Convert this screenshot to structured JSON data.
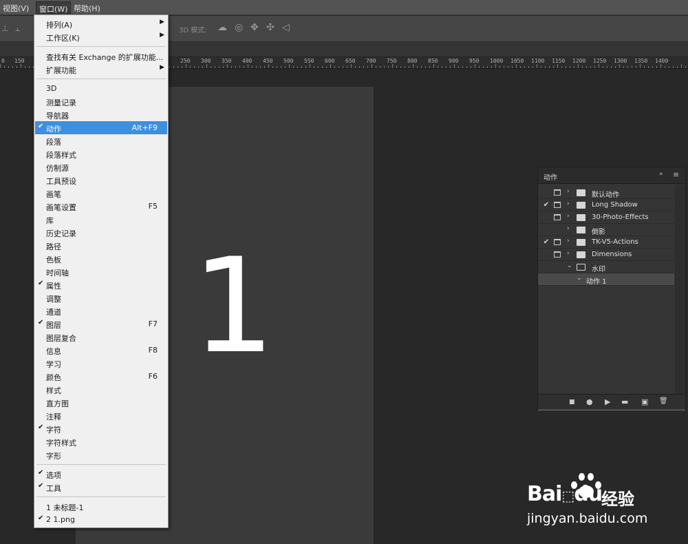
{
  "menubar": {
    "items": [
      {
        "label": "视图(V)"
      },
      {
        "label": "窗口(W)"
      },
      {
        "label": "帮助(H)"
      }
    ]
  },
  "options_bar": {
    "mode_3d_label": "3D 模式:"
  },
  "ruler": {
    "labels": [
      "0",
      "150",
      "250",
      "300",
      "350",
      "400",
      "450",
      "500",
      "550",
      "600",
      "650",
      "700",
      "750",
      "800",
      "850",
      "900",
      "950",
      "1000",
      "1050",
      "1100",
      "1150",
      "1200",
      "1250",
      "1300",
      "1350",
      "1400"
    ]
  },
  "canvas": {
    "content": "1"
  },
  "window_menu": {
    "items": [
      {
        "label": "排列(A)",
        "submenu": true
      },
      {
        "label": "工作区(K)",
        "submenu": true
      },
      {
        "separator": true
      },
      {
        "label": "查找有关 Exchange 的扩展功能..."
      },
      {
        "label": "扩展功能",
        "submenu": true
      },
      {
        "separator": true
      },
      {
        "label": "3D"
      },
      {
        "label": "测量记录"
      },
      {
        "label": "导航器"
      },
      {
        "label": "动作",
        "checked": true,
        "shortcut": "Alt+F9",
        "highlighted": true
      },
      {
        "label": "段落"
      },
      {
        "label": "段落样式"
      },
      {
        "label": "仿制源"
      },
      {
        "label": "工具预设"
      },
      {
        "label": "画笔"
      },
      {
        "label": "画笔设置",
        "shortcut": "F5"
      },
      {
        "label": "库"
      },
      {
        "label": "历史记录"
      },
      {
        "label": "路径"
      },
      {
        "label": "色板"
      },
      {
        "label": "时间轴"
      },
      {
        "label": "属性",
        "checked": true
      },
      {
        "label": "调整"
      },
      {
        "label": "通道"
      },
      {
        "label": "图层",
        "checked": true,
        "shortcut": "F7"
      },
      {
        "label": "图层复合"
      },
      {
        "label": "信息",
        "shortcut": "F8"
      },
      {
        "label": "学习"
      },
      {
        "label": "颜色",
        "shortcut": "F6"
      },
      {
        "label": "样式"
      },
      {
        "label": "直方图"
      },
      {
        "label": "注释"
      },
      {
        "label": "字符",
        "checked": true
      },
      {
        "label": "字符样式"
      },
      {
        "label": "字形"
      },
      {
        "separator": true
      },
      {
        "label": "选项",
        "checked": true
      },
      {
        "label": "工具",
        "checked": true
      },
      {
        "separator": true
      },
      {
        "label": "1 未标题-1"
      },
      {
        "label": "2 1.png",
        "checked": true
      }
    ]
  },
  "actions_panel": {
    "title": "动作",
    "collapse_glyph": "»",
    "menu_glyph": "≡",
    "rows": [
      {
        "label": "默认动作",
        "checked": false,
        "dialog": true,
        "expanded": false,
        "folder": true
      },
      {
        "label": "Long Shadow",
        "checked": true,
        "dialog": true,
        "expanded": false,
        "folder": true
      },
      {
        "label": "30-Photo-Effects",
        "checked": false,
        "dialog": true,
        "expanded": false,
        "folder": true
      },
      {
        "label": "倒影",
        "checked": false,
        "dialog": false,
        "expanded": false,
        "folder": true
      },
      {
        "label": "TK-V5-Actions",
        "checked": true,
        "dialog": true,
        "expanded": false,
        "folder": true
      },
      {
        "label": "Dimensions",
        "checked": false,
        "dialog": true,
        "expanded": false,
        "folder": true
      },
      {
        "label": "水印",
        "checked": false,
        "dialog": false,
        "expanded": true,
        "folder": true
      },
      {
        "label": "动作 1",
        "checked": false,
        "dialog": false,
        "expanded": true,
        "folder": false,
        "selected": true
      }
    ],
    "footer": {
      "stop": "■",
      "record": "●",
      "play": "▶",
      "new_set": "▬",
      "new_action": "▣",
      "delete": "🗑"
    }
  },
  "watermark": {
    "brand": "Bai",
    "brand2": "du",
    "sub": "经验",
    "url": "jingyan.baidu.com"
  }
}
